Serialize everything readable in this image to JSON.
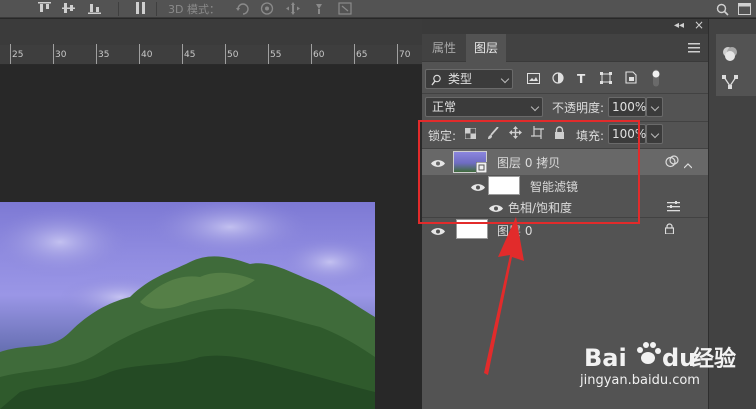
{
  "toolbar": {
    "mode_3d_label": "3D 模式："
  },
  "ruler": {
    "ticks": [
      "25",
      "30",
      "35",
      "40",
      "45",
      "50",
      "55",
      "60",
      "65",
      "70"
    ]
  },
  "panel": {
    "collapse_arrows": "◂◂",
    "close": "×",
    "tabs": [
      {
        "label": "属性",
        "active": false
      },
      {
        "label": "图层",
        "active": true
      }
    ],
    "filter": {
      "value": "类型"
    },
    "blend_mode": {
      "value": "正常"
    },
    "opacity": {
      "label": "不透明度:",
      "value": "100%"
    },
    "lock": {
      "label": "锁定:"
    },
    "fill": {
      "label": "填充:",
      "value": "100%"
    },
    "layers": [
      {
        "name": "图层 0 拷贝",
        "type": "smart-object",
        "visible": true
      },
      {
        "name": "智能滤镜",
        "type": "smart-filter",
        "visible": true
      },
      {
        "name": "色相/饱和度",
        "type": "filter",
        "visible": true
      },
      {
        "name": "图层 0",
        "type": "background",
        "visible": true,
        "locked": true
      }
    ]
  },
  "watermark": {
    "brand": "Bai",
    "brand2": "du",
    "cn": "经验",
    "url": "jingyan.baidu.com"
  },
  "colors": {
    "annotation": "#e22b2b",
    "panel_bg": "#535353",
    "canvas_bg": "#282828"
  }
}
